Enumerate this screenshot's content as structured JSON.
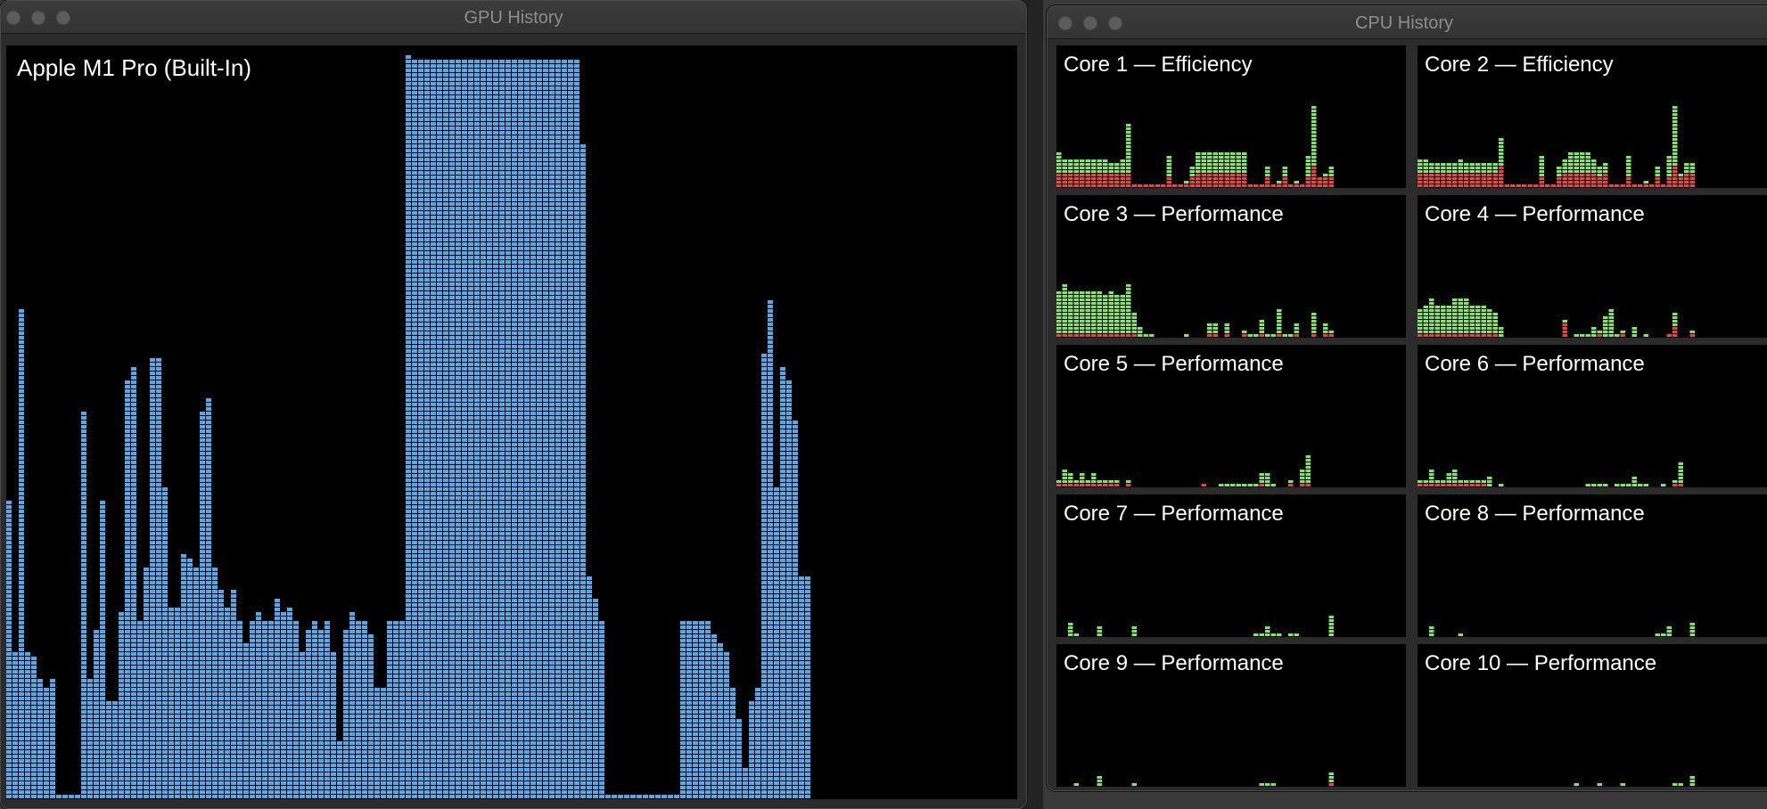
{
  "gpu_window": {
    "title": "GPU History",
    "gpu_name": "Apple M1 Pro (Built-In)",
    "bar_color": "#5aa7e8",
    "usage_percent": [
      40,
      20,
      66,
      20,
      19,
      16,
      15,
      16,
      0,
      0,
      0,
      0,
      52,
      16,
      23,
      40,
      13,
      13,
      25,
      56,
      58,
      24,
      31,
      59,
      59,
      42,
      26,
      26,
      33,
      32,
      31,
      52,
      54,
      31,
      28,
      26,
      28,
      24,
      21,
      24,
      25,
      24,
      24,
      27,
      25,
      26,
      24,
      20,
      23,
      24,
      23,
      24,
      20,
      8,
      23,
      25,
      24,
      24,
      22,
      15,
      15,
      24,
      24,
      24,
      100,
      99,
      99,
      99,
      99,
      99,
      99,
      99,
      99,
      99,
      99,
      99,
      99,
      99,
      99,
      99,
      99,
      99,
      99,
      99,
      99,
      99,
      99,
      99,
      99,
      99,
      99,
      99,
      88,
      30,
      27,
      24,
      0,
      0,
      0,
      0,
      0,
      0,
      0,
      0,
      0,
      0,
      0,
      0,
      24,
      24,
      24,
      24,
      24,
      22,
      21,
      20,
      15,
      11,
      4,
      13,
      15,
      60,
      67,
      42,
      58,
      56,
      51,
      30,
      30
    ]
  },
  "cpu_window": {
    "title": "CPU History",
    "user_color": "#7ee65f",
    "system_color": "#e8463d",
    "cores": [
      {
        "label": "Core 1 — Efficiency",
        "user_percent": [
          20,
          15,
          15,
          15,
          15,
          15,
          15,
          15,
          15,
          10,
          10,
          15,
          50,
          0,
          0,
          0,
          0,
          0,
          0,
          20,
          0,
          0,
          5,
          10,
          20,
          20,
          20,
          20,
          20,
          20,
          20,
          20,
          20,
          0,
          0,
          0,
          10,
          0,
          5,
          10,
          0,
          5,
          0,
          20,
          60,
          0,
          5,
          10
        ],
        "system_percent": [
          15,
          15,
          15,
          15,
          15,
          15,
          15,
          15,
          15,
          15,
          15,
          15,
          15,
          5,
          5,
          5,
          5,
          5,
          5,
          10,
          5,
          5,
          5,
          10,
          15,
          15,
          15,
          15,
          15,
          15,
          15,
          15,
          15,
          5,
          5,
          5,
          10,
          5,
          5,
          10,
          5,
          5,
          5,
          10,
          20,
          10,
          10,
          10
        ]
      },
      {
        "label": "Core 2 — Efficiency",
        "user_percent": [
          15,
          15,
          10,
          10,
          10,
          10,
          10,
          15,
          10,
          10,
          10,
          10,
          10,
          10,
          30,
          0,
          0,
          0,
          0,
          0,
          0,
          20,
          0,
          0,
          10,
          15,
          20,
          20,
          20,
          20,
          15,
          10,
          10,
          0,
          0,
          0,
          20,
          0,
          0,
          5,
          0,
          10,
          0,
          20,
          60,
          5,
          10,
          10
        ],
        "system_percent": [
          15,
          15,
          15,
          15,
          15,
          15,
          15,
          15,
          15,
          15,
          15,
          15,
          15,
          15,
          20,
          5,
          5,
          5,
          5,
          5,
          5,
          10,
          5,
          5,
          10,
          15,
          15,
          15,
          15,
          15,
          15,
          10,
          15,
          5,
          5,
          5,
          10,
          5,
          5,
          5,
          5,
          10,
          5,
          10,
          20,
          10,
          15,
          15
        ]
      },
      {
        "label": "Core 3 — Performance",
        "user_percent": [
          45,
          50,
          45,
          45,
          45,
          45,
          45,
          45,
          40,
          45,
          40,
          40,
          50,
          20,
          10,
          5,
          5,
          0,
          0,
          0,
          0,
          0,
          5,
          0,
          0,
          0,
          10,
          10,
          0,
          10,
          0,
          0,
          5,
          5,
          5,
          15,
          5,
          5,
          25,
          5,
          5,
          10,
          0,
          0,
          20,
          0,
          10,
          5
        ],
        "system_percent": [
          5,
          5,
          5,
          5,
          5,
          5,
          5,
          5,
          5,
          5,
          5,
          5,
          5,
          5,
          0,
          0,
          0,
          0,
          0,
          0,
          0,
          0,
          0,
          0,
          0,
          0,
          5,
          5,
          0,
          5,
          0,
          0,
          5,
          0,
          0,
          5,
          0,
          0,
          5,
          0,
          0,
          5,
          0,
          0,
          5,
          0,
          5,
          5
        ]
      },
      {
        "label": "Core 4 — Performance",
        "user_percent": [
          25,
          30,
          35,
          30,
          30,
          30,
          35,
          35,
          35,
          30,
          30,
          30,
          25,
          20,
          10,
          0,
          0,
          0,
          0,
          0,
          0,
          0,
          0,
          0,
          0,
          5,
          0,
          5,
          5,
          5,
          10,
          5,
          20,
          30,
          5,
          5,
          0,
          10,
          0,
          5,
          0,
          0,
          0,
          0,
          15,
          0,
          0,
          5
        ],
        "system_percent": [
          5,
          5,
          5,
          5,
          5,
          5,
          5,
          5,
          5,
          5,
          5,
          5,
          5,
          5,
          0,
          0,
          0,
          0,
          0,
          0,
          0,
          0,
          0,
          0,
          0,
          15,
          0,
          0,
          0,
          0,
          0,
          5,
          0,
          0,
          0,
          5,
          0,
          0,
          0,
          0,
          0,
          0,
          0,
          5,
          10,
          0,
          0,
          5
        ]
      },
      {
        "label": "Core 5 — Performance",
        "user_percent": [
          5,
          15,
          10,
          5,
          10,
          5,
          10,
          5,
          5,
          5,
          5,
          0,
          5,
          0,
          0,
          0,
          0,
          0,
          0,
          0,
          0,
          0,
          0,
          0,
          0,
          0,
          0,
          0,
          5,
          5,
          5,
          5,
          5,
          5,
          5,
          10,
          15,
          5,
          0,
          0,
          5,
          0,
          15,
          30,
          0,
          0,
          0,
          0
        ],
        "system_percent": [
          5,
          5,
          5,
          5,
          5,
          5,
          5,
          5,
          5,
          5,
          5,
          0,
          5,
          0,
          0,
          0,
          0,
          0,
          0,
          0,
          0,
          0,
          0,
          0,
          0,
          5,
          0,
          0,
          0,
          0,
          0,
          0,
          0,
          0,
          0,
          5,
          0,
          0,
          0,
          0,
          5,
          0,
          5,
          5,
          0,
          0,
          0,
          0
        ]
      },
      {
        "label": "Core 6 — Performance",
        "user_percent": [
          5,
          5,
          15,
          5,
          5,
          10,
          15,
          5,
          5,
          5,
          5,
          5,
          10,
          0,
          5,
          0,
          0,
          0,
          0,
          0,
          0,
          0,
          0,
          0,
          0,
          0,
          0,
          0,
          0,
          5,
          5,
          5,
          5,
          0,
          5,
          5,
          5,
          10,
          5,
          5,
          0,
          0,
          5,
          0,
          5,
          20,
          0,
          0
        ],
        "system_percent": [
          5,
          5,
          5,
          5,
          5,
          5,
          5,
          5,
          5,
          5,
          5,
          5,
          0,
          0,
          0,
          0,
          0,
          0,
          0,
          0,
          0,
          0,
          0,
          0,
          0,
          0,
          0,
          0,
          0,
          0,
          0,
          0,
          0,
          0,
          0,
          0,
          0,
          0,
          0,
          0,
          0,
          0,
          0,
          0,
          5,
          5,
          0,
          0
        ]
      },
      {
        "label": "Core 7 — Performance",
        "user_percent": [
          0,
          0,
          15,
          5,
          0,
          0,
          0,
          10,
          0,
          0,
          0,
          0,
          0,
          10,
          0,
          0,
          0,
          0,
          0,
          0,
          0,
          0,
          0,
          0,
          0,
          0,
          0,
          0,
          0,
          0,
          0,
          0,
          0,
          0,
          5,
          5,
          10,
          5,
          5,
          0,
          5,
          5,
          0,
          0,
          0,
          0,
          0,
          20
        ],
        "system_percent": [
          0,
          0,
          0,
          0,
          0,
          0,
          0,
          0,
          0,
          0,
          0,
          0,
          0,
          0,
          0,
          0,
          0,
          0,
          0,
          0,
          0,
          0,
          0,
          0,
          0,
          0,
          0,
          0,
          0,
          0,
          0,
          0,
          0,
          0,
          0,
          0,
          0,
          0,
          0,
          0,
          0,
          0,
          0,
          0,
          0,
          0,
          0,
          0
        ]
      },
      {
        "label": "Core 8 — Performance",
        "user_percent": [
          0,
          0,
          10,
          0,
          0,
          0,
          0,
          5,
          0,
          0,
          0,
          0,
          0,
          0,
          0,
          0,
          0,
          0,
          0,
          0,
          0,
          0,
          0,
          0,
          0,
          0,
          0,
          0,
          0,
          0,
          0,
          0,
          0,
          0,
          0,
          0,
          0,
          0,
          0,
          0,
          0,
          5,
          5,
          10,
          0,
          0,
          0,
          15
        ],
        "system_percent": [
          0,
          0,
          0,
          0,
          0,
          0,
          0,
          0,
          0,
          0,
          0,
          0,
          0,
          0,
          0,
          0,
          0,
          0,
          0,
          0,
          0,
          0,
          0,
          0,
          0,
          0,
          0,
          0,
          0,
          0,
          0,
          0,
          0,
          0,
          0,
          0,
          0,
          0,
          0,
          0,
          0,
          0,
          0,
          0,
          0,
          0,
          0,
          0
        ]
      },
      {
        "label": "Core 9 — Performance",
        "user_percent": [
          0,
          0,
          0,
          5,
          0,
          0,
          0,
          10,
          0,
          0,
          0,
          0,
          0,
          5,
          0,
          0,
          0,
          0,
          0,
          0,
          0,
          0,
          0,
          0,
          0,
          0,
          0,
          0,
          0,
          0,
          0,
          0,
          0,
          0,
          0,
          5,
          5,
          5,
          0,
          0,
          0,
          0,
          0,
          0,
          0,
          0,
          0,
          10
        ],
        "system_percent": [
          0,
          0,
          0,
          0,
          0,
          0,
          0,
          0,
          0,
          0,
          0,
          0,
          0,
          0,
          0,
          0,
          0,
          0,
          0,
          0,
          0,
          0,
          0,
          0,
          0,
          0,
          0,
          0,
          0,
          0,
          0,
          0,
          0,
          0,
          0,
          0,
          0,
          0,
          0,
          0,
          0,
          0,
          0,
          0,
          0,
          0,
          0,
          5
        ]
      },
      {
        "label": "Core 10 — Performance",
        "user_percent": [
          0,
          0,
          0,
          0,
          0,
          0,
          0,
          0,
          0,
          0,
          0,
          0,
          0,
          0,
          0,
          0,
          0,
          0,
          0,
          0,
          0,
          0,
          0,
          0,
          0,
          0,
          0,
          5,
          0,
          0,
          0,
          5,
          0,
          0,
          0,
          5,
          0,
          0,
          0,
          0,
          0,
          0,
          0,
          0,
          5,
          5,
          0,
          10
        ],
        "system_percent": [
          0,
          0,
          0,
          0,
          0,
          0,
          0,
          0,
          0,
          0,
          0,
          0,
          0,
          0,
          0,
          0,
          0,
          0,
          0,
          0,
          0,
          0,
          0,
          0,
          0,
          0,
          0,
          0,
          0,
          0,
          0,
          0,
          0,
          0,
          0,
          0,
          0,
          0,
          0,
          0,
          0,
          0,
          0,
          0,
          0,
          0,
          0,
          0
        ]
      }
    ]
  }
}
